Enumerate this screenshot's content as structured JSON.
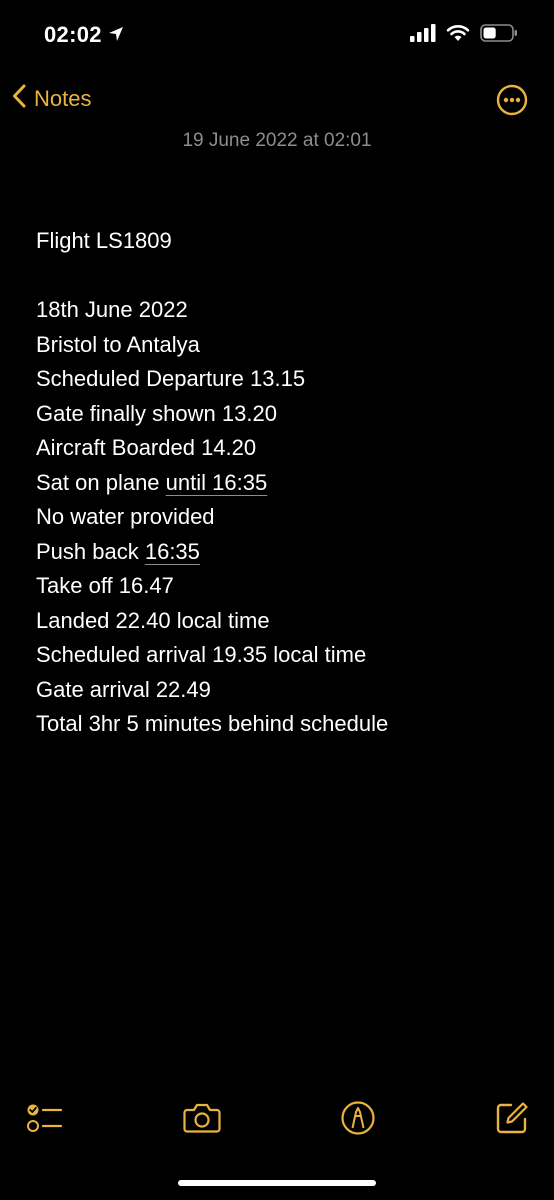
{
  "status_bar": {
    "time": "02:02",
    "location_icon": "location-arrow-icon",
    "signal_icon": "cellular-signal-icon",
    "wifi_icon": "wifi-icon",
    "battery_icon": "battery-icon",
    "battery_level": 0.45
  },
  "nav": {
    "back_label": "Notes",
    "back_icon": "chevron-left-icon",
    "more_icon": "ellipsis-circle-icon"
  },
  "note": {
    "date": "19 June 2022 at 02:01",
    "lines": [
      {
        "text": "Flight LS1809"
      },
      {
        "text": ""
      },
      {
        "text": "18th June 2022"
      },
      {
        "text": "Bristol to Antalya"
      },
      {
        "text": "Scheduled Departure 13.15"
      },
      {
        "text": "Gate finally shown 13.20"
      },
      {
        "text": "Aircraft Boarded 14.20"
      },
      {
        "text": "Sat on plane ",
        "link": "until 16:35"
      },
      {
        "text": "No water provided"
      },
      {
        "text": "Push back ",
        "link": "16:35"
      },
      {
        "text": "Take off 16.47"
      },
      {
        "text": "Landed 22.40 local time"
      },
      {
        "text": "Scheduled arrival 19.35 local time"
      },
      {
        "text": "Gate arrival 22.49"
      },
      {
        "text": "Total 3hr 5 minutes behind schedule"
      }
    ]
  },
  "toolbar": {
    "checklist_icon": "checklist-icon",
    "camera_icon": "camera-icon",
    "markup_icon": "markup-pen-icon",
    "compose_icon": "compose-icon"
  },
  "colors": {
    "accent": "#e9b33d",
    "background": "#000000",
    "secondary_text": "#8d8d92"
  }
}
